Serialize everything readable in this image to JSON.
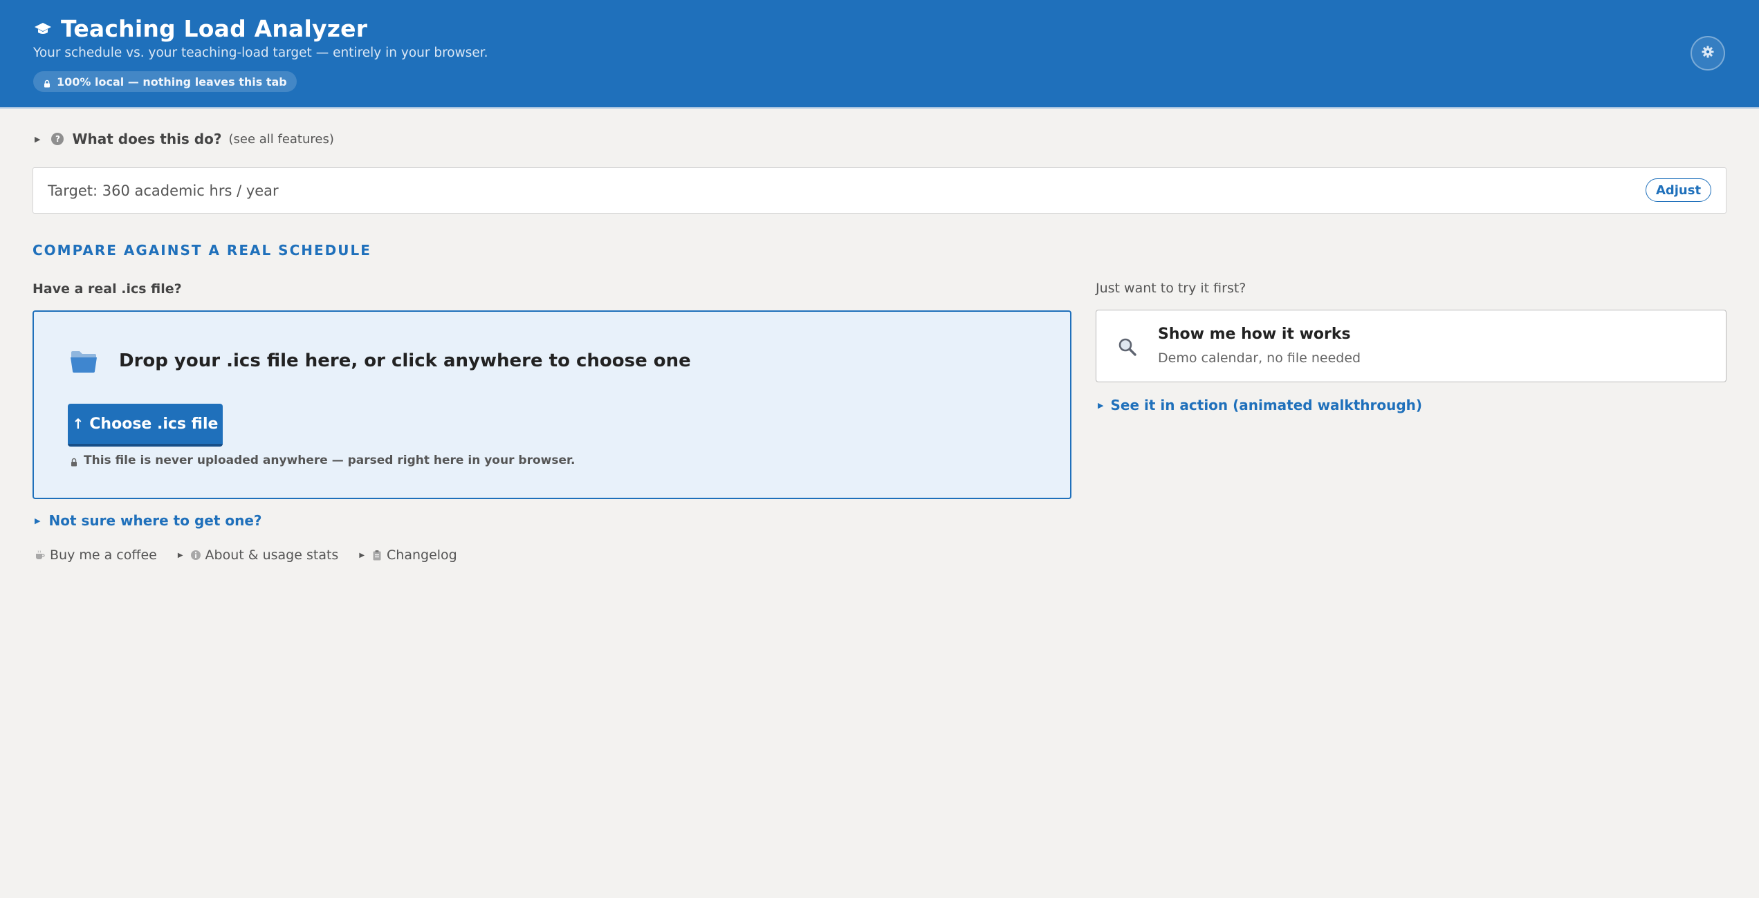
{
  "header": {
    "title": "Teaching Load Analyzer",
    "subtitle": "Your schedule vs. your teaching-load target — entirely in your browser.",
    "badge": "100% local — nothing leaves this tab",
    "icon": "graduation-cap-icon",
    "settings_icon": "gear-icon",
    "color": "#1f70bb"
  },
  "intro": {
    "question": "What does this do?",
    "link": "(see all features)"
  },
  "target": {
    "text": "Target: 360 academic hrs / year",
    "adjust_label": "Adjust"
  },
  "section": {
    "heading": "COMPARE AGAINST A REAL SCHEDULE"
  },
  "upload": {
    "label": "Have a real .ics file?",
    "drop_text": "Drop your .ics file here, or click anywhere to choose one",
    "button_label": "Choose .ics file",
    "privacy_note": "This file is never uploaded anywhere — parsed right here in your browser.",
    "help_link": "Not sure where to get one?"
  },
  "demo": {
    "label": "Just want to try it first?",
    "title": "Show me how it works",
    "subtitle": "Demo calendar, no file needed",
    "walkthrough_link": "See it in action (animated walkthrough)"
  },
  "footer": {
    "coffee": "Buy me a coffee",
    "about": "About & usage stats",
    "changelog": "Changelog"
  }
}
